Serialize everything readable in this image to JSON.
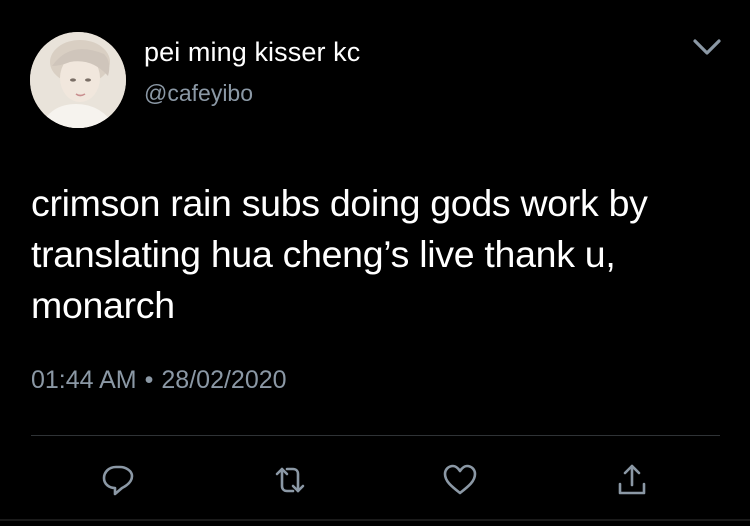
{
  "tweet": {
    "display_name": "pei ming kisser kc",
    "handle": "@cafeyibo",
    "text": "crimson rain subs doing gods work by translating hua cheng’s live thank u, monarch",
    "time": "01:44 AM",
    "separator": "•",
    "date": "28/02/2020"
  },
  "icons": {
    "menu": "chevron-down-icon",
    "reply": "reply-icon",
    "retweet": "retweet-icon",
    "like": "heart-icon",
    "share": "share-icon"
  },
  "colors": {
    "background": "#000000",
    "text": "#ffffff",
    "secondary": "#8b98a5",
    "icon": "#8b98a5",
    "divider": "#2f3336"
  }
}
